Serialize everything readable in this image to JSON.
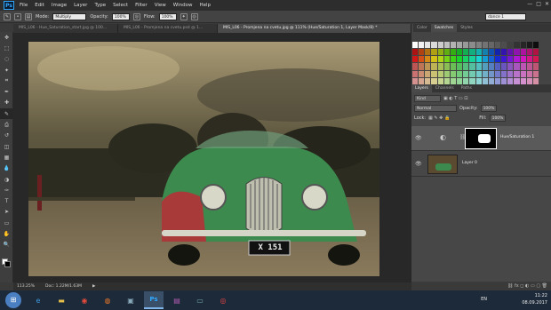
{
  "app": {
    "logo": "Ps"
  },
  "menu": [
    "File",
    "Edit",
    "Image",
    "Layer",
    "Type",
    "Select",
    "Filter",
    "View",
    "Window",
    "Help"
  ],
  "window_controls": [
    "—",
    "□",
    "✕"
  ],
  "options": {
    "mode_label": "Mode:",
    "mode_value": "Multiply",
    "opacity_label": "Opacity:",
    "opacity_value": "100%",
    "flow_label": "Flow:",
    "flow_value": "100%"
  },
  "workspace": "dance 1",
  "tabs": [
    "MIS_L06 - Hue_Saturation_start.jpg @ 100...",
    "MIS_L06 - Promjena na cvetu.psd @ 1...",
    "MIS_L06 - Promjena na cvetu.jpg @ 111% (Hue/Saturation 1, Layer Mask/8) *"
  ],
  "plate_text": "X 151",
  "status": {
    "zoom": "113.25%",
    "doc": "Doc: 1.22M/1.63M"
  },
  "top_panel_tabs": [
    "Color",
    "Swatches",
    "Styles"
  ],
  "layers_tabs": [
    "Layers",
    "Channels",
    "Paths"
  ],
  "layers_controls": {
    "kind": "Kind",
    "blend": "Normal",
    "opacity_label": "Opacity:",
    "opacity_value": "100%",
    "lock_label": "Lock:",
    "fill_label": "Fill:",
    "fill_value": "100%"
  },
  "layers": [
    {
      "name": "Hue/Saturation 1",
      "selected": true
    },
    {
      "name": "Layer 0",
      "selected": false
    }
  ],
  "tray": {
    "lang": "EN",
    "time": "11:22",
    "date": "08.09.2017"
  },
  "colors": {
    "accent": "#31a8ff",
    "menubar": "#2d2d2d",
    "panel": "#474747",
    "taskbar": "#1c2a3a"
  },
  "tool_icons": [
    "move-icon",
    "marquee-icon",
    "lasso-icon",
    "quick-select-icon",
    "crop-icon",
    "eyedropper-icon",
    "healing-icon",
    "brush-icon",
    "stamp-icon",
    "history-brush-icon",
    "eraser-icon",
    "gradient-icon",
    "blur-icon",
    "dodge-icon",
    "pen-icon",
    "type-icon",
    "path-select-icon",
    "shape-icon",
    "hand-icon",
    "zoom-icon"
  ]
}
